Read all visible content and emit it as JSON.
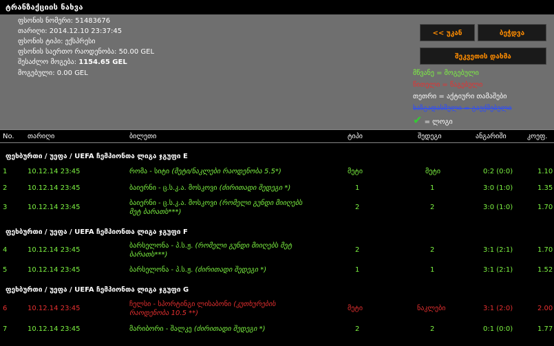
{
  "title": "ტრანზაქციის ნახვა",
  "info": {
    "slip_number": "ფსონის ნომერი: 51483676",
    "date": "თარიღი: 2014.12.10 23:37:45",
    "type": "ფსონის ტიპი: ექსპრესი",
    "total_amount": "ფსონის საერთო რაოდენობა: 50.00 GEL",
    "possible_win_label": "შესაძლო მოგება:",
    "possible_win_value": "1154.65 GEL",
    "won": "მოგებული: 0.00 GEL"
  },
  "buttons": {
    "back": "<< უკან",
    "print": "ბეჭდვა",
    "reorder": "შეკვეთის დახმა"
  },
  "legend": {
    "green": "მწვანე = მოგებული",
    "red": "წითელი = წაგებული",
    "white": "თეთრი = აქტიური თამაშები",
    "blue": "ხაზგადასმული = გაუქმებული",
    "check": "= ლოგი",
    "check_icon": "checkmark-icon"
  },
  "colors": {
    "green": "#7ef542",
    "red": "#e83030",
    "white": "#ffffff",
    "blue": "#2b4cff",
    "orange": "#ff8c00"
  },
  "headers": {
    "no": "No.",
    "date": "თარიღი",
    "event": "ბილეთი",
    "type": "ტიპი",
    "bet": "შედეგი",
    "score": "ანგარიში",
    "odds": "კოეფ."
  },
  "groups": [
    {
      "title": "ფეხბურთი / უეფა / UEFA ჩემპიონთა ლიგა ჯგუფი E"
    },
    {
      "title": "ფეხბურთი / უეფა / UEFA ჩემპიონთა ლიგა ჯგუფი F"
    },
    {
      "title": "ფეხბურთი / უეფა / UEFA ჩემპიონთა ლიგა ჯგუფი G"
    }
  ],
  "rows": [
    {
      "no": "1",
      "date": "10.12.14 23:45",
      "event": "რომა - სიტი",
      "detail": "(მეტი/ნაკლები რაოდენობა 5.5*)",
      "type": "მეტი",
      "bet": "მეტი",
      "score": "0:2 (0:0)",
      "odds": "1.10"
    },
    {
      "no": "2",
      "date": "10.12.14 23:45",
      "event": "ბაიერნი - ც.ს.კ.ა. მოსკოვი",
      "detail": "(ძირითადი შედეგი *)",
      "type": "1",
      "bet": "1",
      "score": "3:0 (1:0)",
      "odds": "1.35"
    },
    {
      "no": "3",
      "date": "10.12.14 23:45",
      "event": "ბაიერნი - ც.ს.კ.ა. მოსკოვი",
      "detail": "(რომელი გუნდი მიიღებს",
      "detail2": "მეტ ბარათს***)",
      "type": "2",
      "bet": "2",
      "score": "3:0 (1:0)",
      "odds": "1.70"
    },
    {
      "no": "4",
      "date": "10.12.14 23:45",
      "event": "ბარსელონა - პ.ს.ჟ.",
      "detail": "(რომელი გუნდი მიიღებს მეტ",
      "detail2": "ბარათს***)",
      "type": "2",
      "bet": "2",
      "score": "3:1 (2:1)",
      "odds": "1.70"
    },
    {
      "no": "5",
      "date": "10.12.14 23:45",
      "event": "ბარსელონა - პ.ს.ჟ.",
      "detail": "(ძირითადი შედეგი *)",
      "type": "1",
      "bet": "1",
      "score": "3:1 (2:1)",
      "odds": "1.52"
    },
    {
      "no": "6",
      "date": "10.12.14 23:45",
      "event": "ჩელსი - სპორტინგი ლისაბონი",
      "detail": "(კუთხურების",
      "detail2": "რაოდენობა 10.5 **)",
      "type": "მეტი",
      "bet": "ნაკლები",
      "score": "3:1 (2:0)",
      "odds": "2.00"
    },
    {
      "no": "7",
      "date": "10.12.14 23:45",
      "event": "მარიბორი - შალკე",
      "detail": "(ძირითადი შედეგი *)",
      "type": "2",
      "bet": "2",
      "score": "0:1 (0:0)",
      "odds": "1.77"
    }
  ]
}
